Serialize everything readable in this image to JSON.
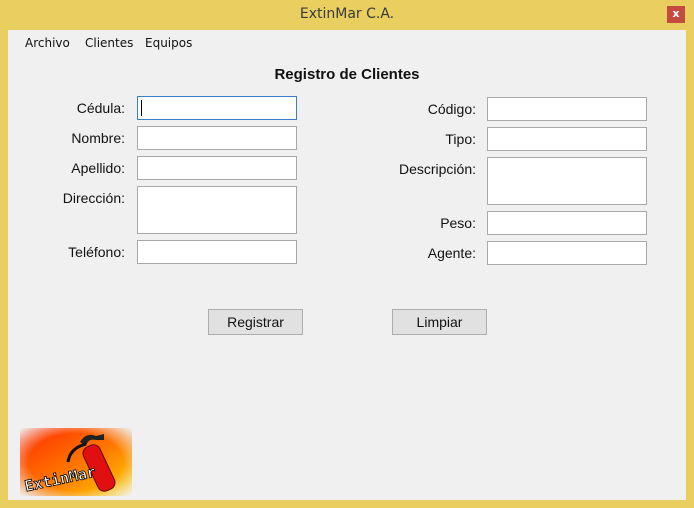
{
  "window": {
    "title": "ExtinMar C.A.",
    "close_label": "x",
    "frame_color": "#e8cf60",
    "close_color": "#c54a3f"
  },
  "menu": {
    "items": [
      "Archivo",
      "Clientes",
      "Equipos"
    ]
  },
  "form": {
    "title": "Registro de Clientes",
    "labels": {
      "cedula": "Cédula:",
      "nombre": "Nombre:",
      "apellido": "Apellido:",
      "direccion": "Dirección:",
      "telefono": "Teléfono:",
      "codigo": "Código:",
      "tipo": "Tipo:",
      "descripcion": "Descripción:",
      "peso": "Peso:",
      "agente": "Agente:"
    },
    "values": {
      "cedula": "",
      "nombre": "",
      "apellido": "",
      "direccion": "",
      "telefono": "",
      "codigo": "",
      "tipo": "",
      "descripcion": "",
      "peso": "",
      "agente": ""
    }
  },
  "buttons": {
    "register": "Registrar",
    "clear": "Limpiar"
  },
  "logo": {
    "text": "ExtinMar",
    "icon": "fire-extinguisher-icon"
  }
}
